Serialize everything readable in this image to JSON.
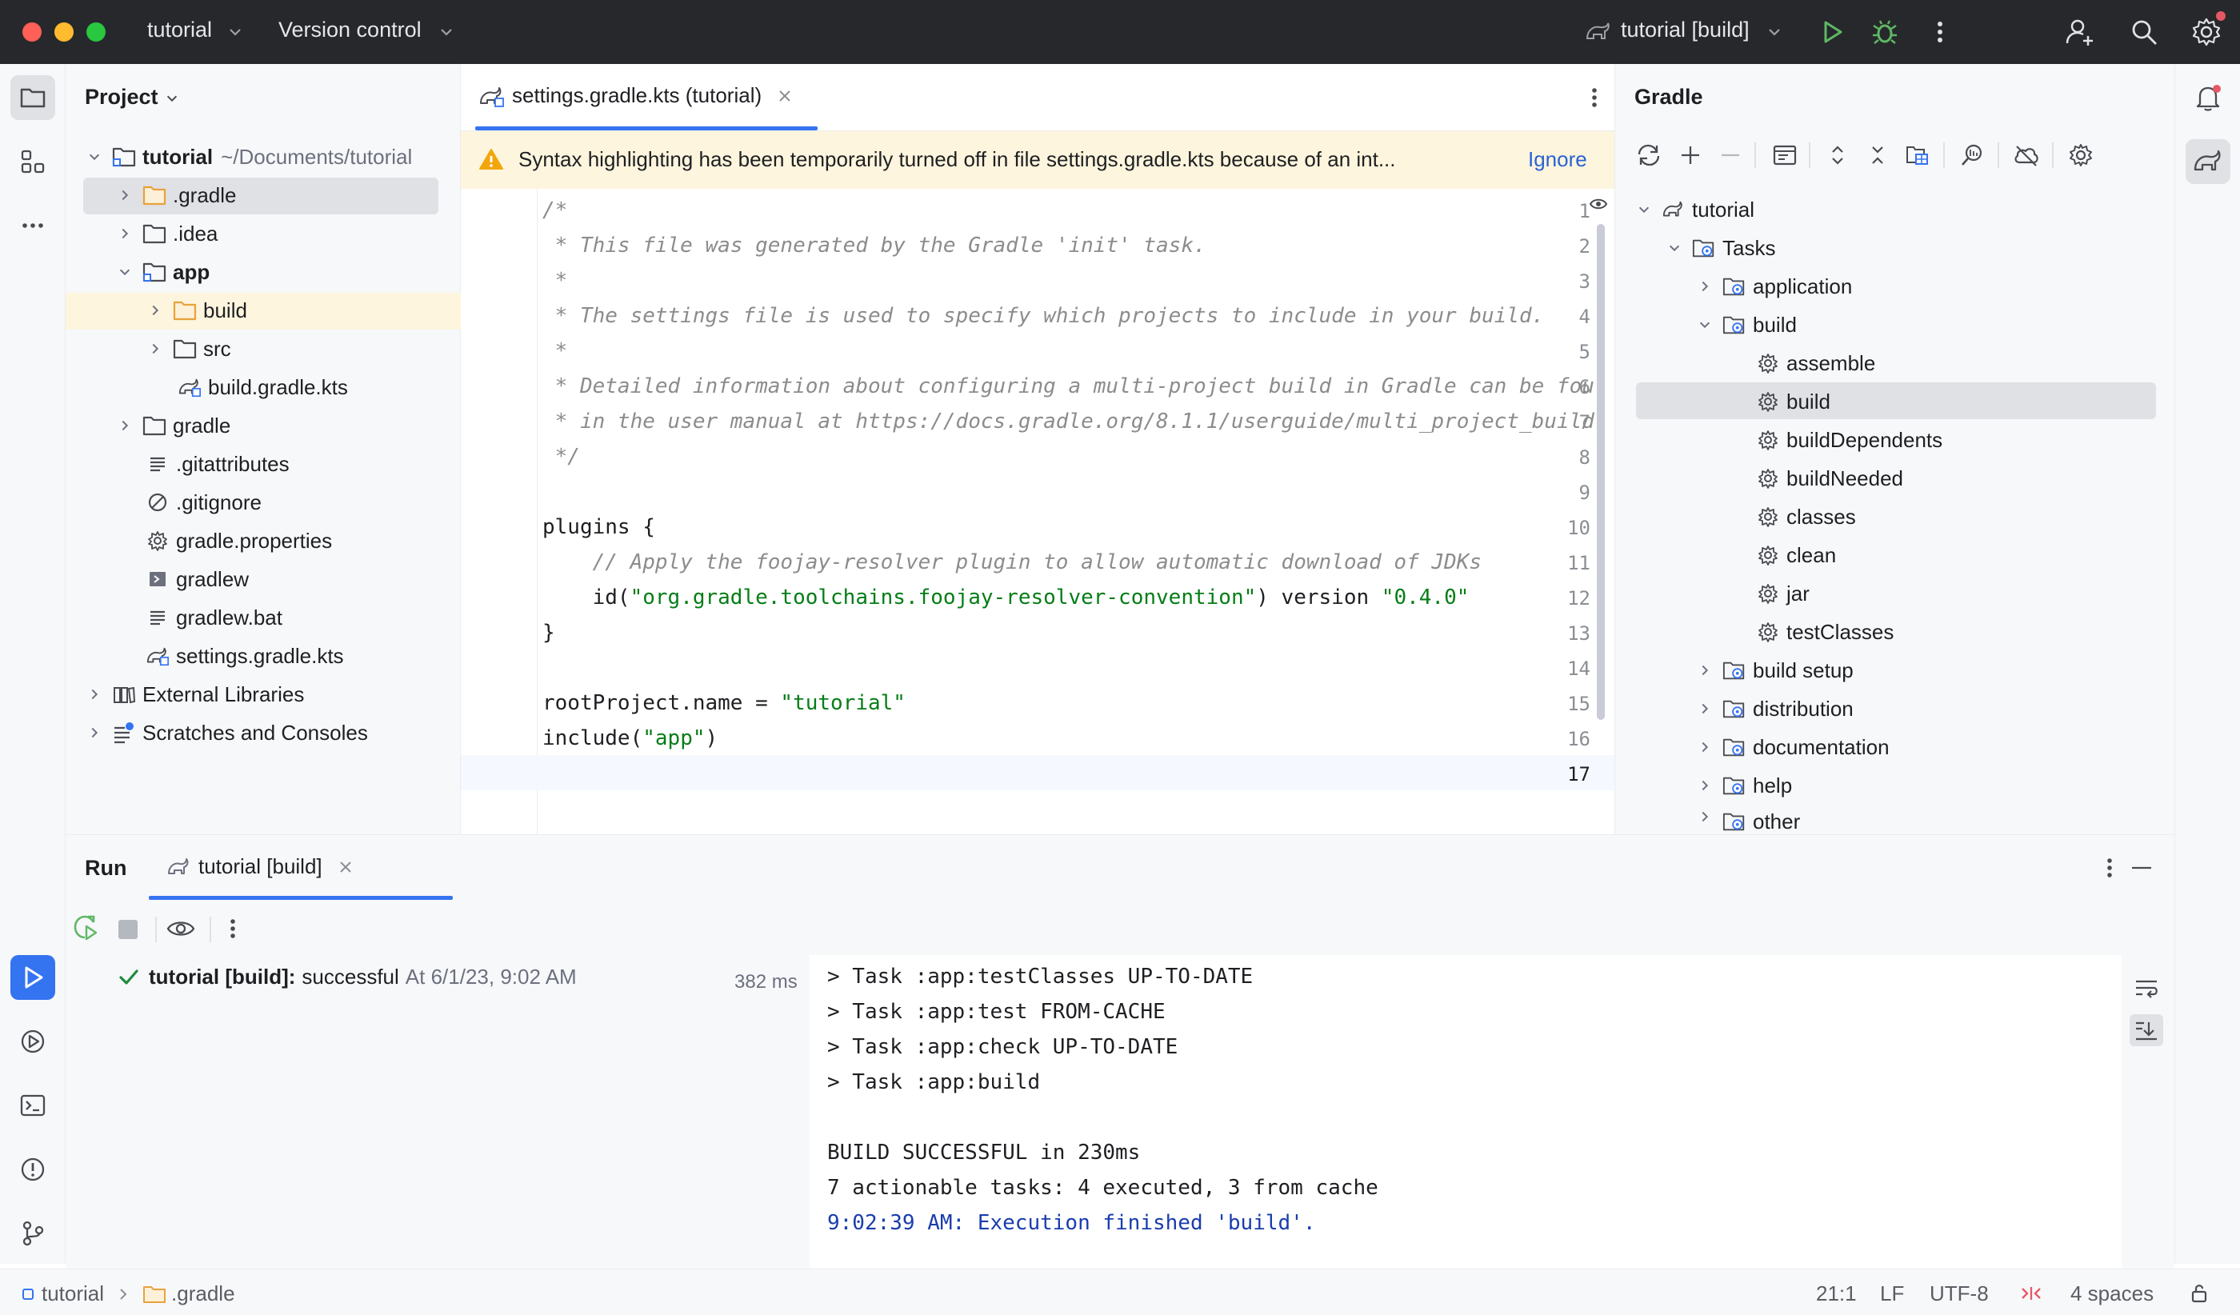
{
  "titlebar": {
    "project_name": "tutorial",
    "vcs_label": "Version control",
    "run_config": "tutorial [build]"
  },
  "project_panel": {
    "title": "Project",
    "tree": [
      {
        "label": "tutorial",
        "suffix": "~/Documents/tutorial"
      },
      {
        "label": ".gradle"
      },
      {
        "label": ".idea"
      },
      {
        "label": "app"
      },
      {
        "label": "build"
      },
      {
        "label": "src"
      },
      {
        "label": "build.gradle.kts"
      },
      {
        "label": "gradle"
      },
      {
        "label": ".gitattributes"
      },
      {
        "label": ".gitignore"
      },
      {
        "label": "gradle.properties"
      },
      {
        "label": "gradlew"
      },
      {
        "label": "gradlew.bat"
      },
      {
        "label": "settings.gradle.kts"
      },
      {
        "label": "External Libraries"
      },
      {
        "label": "Scratches and Consoles"
      }
    ]
  },
  "editor": {
    "tab_label": "settings.gradle.kts (tutorial)",
    "warning": "Syntax highlighting has been temporarily turned off in file settings.gradle.kts because of an int...",
    "warning_action": "Ignore",
    "line_numbers": [
      "1",
      "2",
      "3",
      "4",
      "5",
      "6",
      "7",
      "8",
      "9",
      "10",
      "11",
      "12",
      "13",
      "14",
      "15",
      "16",
      "17"
    ],
    "lines": {
      "l1": "/*",
      "l2": " * This file was generated by the Gradle 'init' task.",
      "l3": " *",
      "l4": " * The settings file is used to specify which projects to include in your build.",
      "l5": " *",
      "l6": " * Detailed information about configuring a multi-project build in Gradle can be fou",
      "l7": " * in the user manual at https://docs.gradle.org/8.1.1/userguide/multi_project_build",
      "l8": " */",
      "l10": "plugins {",
      "l11": "    // Apply the foojay-resolver plugin to allow automatic download of JDKs",
      "l12_a": "    id(",
      "l12_b": "\"org.gradle.toolchains.foojay-resolver-convention\"",
      "l12_c": ") version ",
      "l12_d": "\"0.4.0\"",
      "l13": "}",
      "l15_a": "rootProject.name = ",
      "l15_b": "\"tutorial\"",
      "l16_a": "include(",
      "l16_b": "\"app\"",
      "l16_c": ")"
    }
  },
  "gradle_panel": {
    "title": "Gradle",
    "tree": [
      {
        "label": "tutorial"
      },
      {
        "label": "Tasks"
      },
      {
        "label": "application"
      },
      {
        "label": "build"
      },
      {
        "label": "assemble"
      },
      {
        "label": "build"
      },
      {
        "label": "buildDependents"
      },
      {
        "label": "buildNeeded"
      },
      {
        "label": "classes"
      },
      {
        "label": "clean"
      },
      {
        "label": "jar"
      },
      {
        "label": "testClasses"
      },
      {
        "label": "build setup"
      },
      {
        "label": "distribution"
      },
      {
        "label": "documentation"
      },
      {
        "label": "help"
      },
      {
        "label": "other"
      }
    ]
  },
  "run_panel": {
    "title": "Run",
    "tab_label": "tutorial [build]",
    "result_name": "tutorial [build]:",
    "result_status": "successful",
    "result_time": "At 6/1/23, 9:02 AM",
    "duration": "382 ms",
    "console": [
      "> Task :app:testClasses UP-TO-DATE",
      "> Task :app:test FROM-CACHE",
      "> Task :app:check UP-TO-DATE",
      "> Task :app:build",
      "",
      "BUILD SUCCESSFUL in 230ms",
      "7 actionable tasks: 4 executed, 3 from cache",
      "9:02:39 AM: Execution finished 'build'."
    ]
  },
  "statusbar": {
    "crumb_project": "tutorial",
    "crumb_folder": ".gradle",
    "position": "21:1",
    "line_sep": "LF",
    "encoding": "UTF-8",
    "indent": "4 spaces"
  },
  "colors": {
    "titlebar_bg": "#27282c",
    "accent": "#3574f0",
    "warning_bg": "#fdf5dd",
    "string_green": "#067d17",
    "comment_gray": "#8c8c8c",
    "success_green": "#208a3c",
    "folder_orange": "#e9a23b"
  }
}
